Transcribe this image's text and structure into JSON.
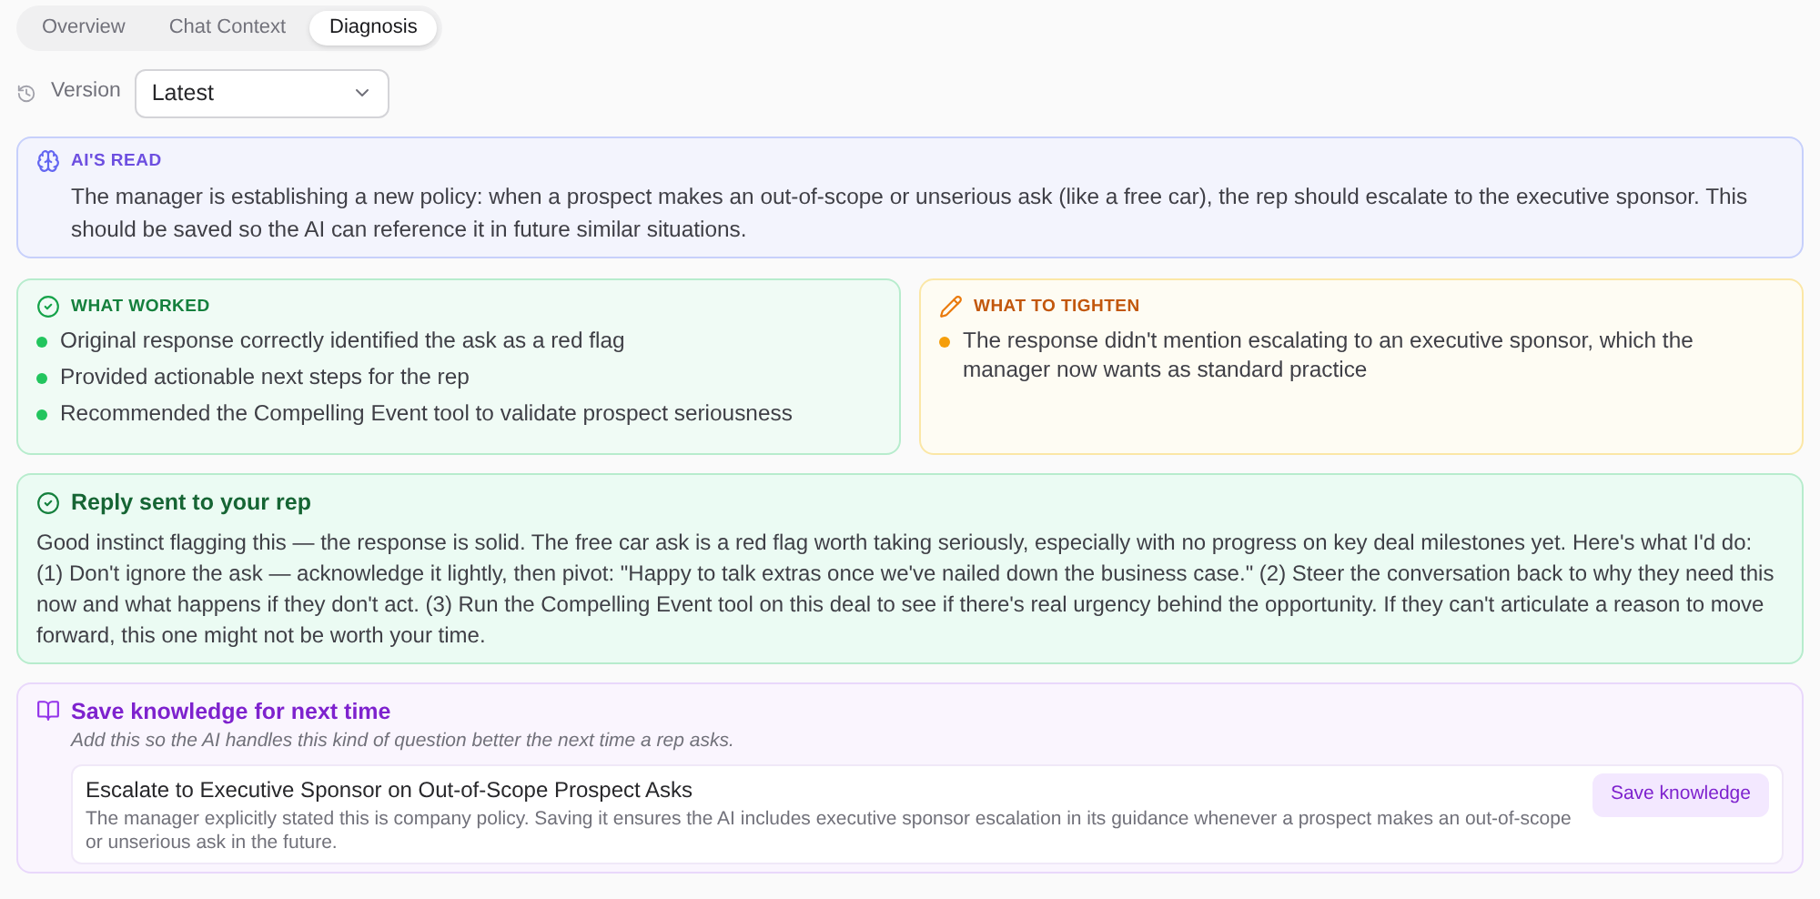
{
  "tabs": [
    {
      "label": "Overview",
      "selected": false
    },
    {
      "label": "Chat Context",
      "selected": false
    },
    {
      "label": "Diagnosis",
      "selected": true
    }
  ],
  "version": {
    "label": "Version",
    "value": "Latest"
  },
  "ai_read": {
    "title": "AI'S READ",
    "text": "The manager is establishing a new policy: when a prospect makes an out-of-scope or unserious ask (like a free car), the rep should escalate to the executive sponsor. This should be saved so the AI can reference it in future similar situations."
  },
  "what_worked": {
    "title": "WHAT WORKED",
    "items": [
      "Original response correctly identified the ask as a red flag",
      "Provided actionable next steps for the rep",
      "Recommended the Compelling Event tool to validate prospect seriousness"
    ]
  },
  "what_to_tighten": {
    "title": "WHAT TO TIGHTEN",
    "items": [
      "The response didn't mention escalating to an executive sponsor, which the manager now wants as standard practice"
    ]
  },
  "reply": {
    "title": "Reply sent to your rep",
    "text": "Good instinct flagging this — the response is solid. The free car ask is a red flag worth taking seriously, especially with no progress on key deal milestones yet. Here's what I'd do: (1) Don't ignore the ask — acknowledge it lightly, then pivot: \"Happy to talk extras once we've nailed down the business case.\" (2) Steer the conversation back to why they need this now and what happens if they don't act. (3) Run the Compelling Event tool on this deal to see if there's real urgency behind the opportunity. If they can't articulate a reason to move forward, this one might not be worth your time."
  },
  "save_knowledge": {
    "title": "Save knowledge for next time",
    "subtitle": "Add this so the AI handles this kind of question better the next time a rep asks.",
    "items": [
      {
        "title": "Escalate to Executive Sponsor on Out-of-Scope Prospect Asks",
        "text": "The manager explicitly stated this is company policy. Saving it ensures the AI includes executive sponsor escalation in its guidance whenever a prospect makes an out-of-scope or unserious ask in the future.",
        "button": "Save knowledge"
      }
    ]
  }
}
